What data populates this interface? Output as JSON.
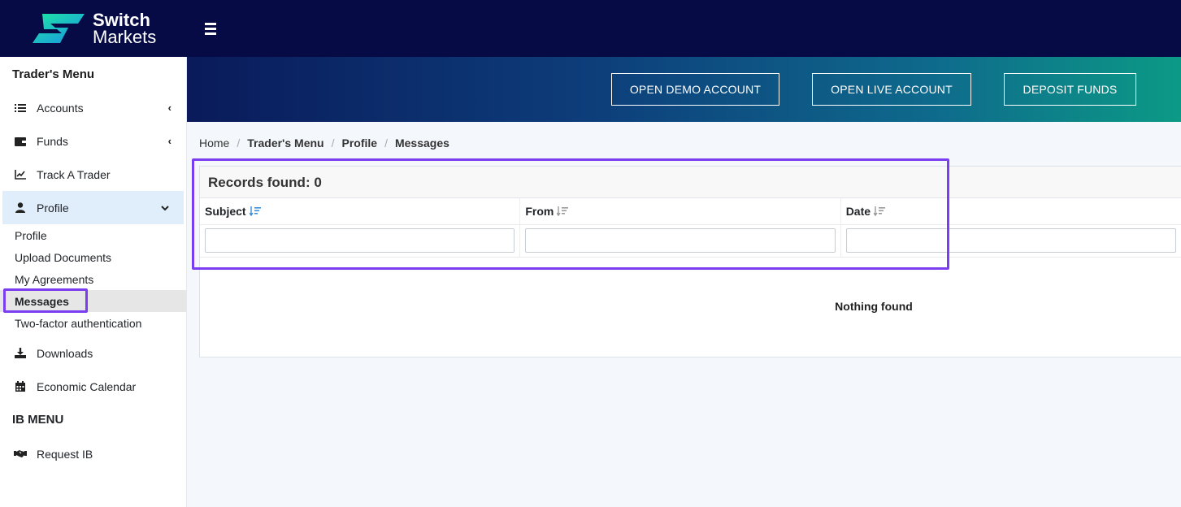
{
  "brand": {
    "line1": "Switch",
    "line2": "Markets"
  },
  "sidebar": {
    "heading": "Trader's Menu",
    "items": [
      {
        "label": "Accounts",
        "icon": "list-icon",
        "chevron": "‹"
      },
      {
        "label": "Funds",
        "icon": "wallet-icon",
        "chevron": "‹"
      },
      {
        "label": "Track A Trader",
        "icon": "chart-line-icon"
      },
      {
        "label": "Profile",
        "icon": "user-icon",
        "chevron": "⌄"
      }
    ],
    "profile_sub": [
      "Profile",
      "Upload Documents",
      "My Agreements",
      "Messages",
      "Two-factor authentication"
    ],
    "more_items": [
      {
        "label": "Downloads",
        "icon": "download-icon"
      },
      {
        "label": "Economic Calendar",
        "icon": "calendar-icon"
      }
    ],
    "ib_heading": "IB MENU",
    "ib_items": [
      {
        "label": "Request IB",
        "icon": "handshake-icon"
      }
    ]
  },
  "banner": {
    "buttons": [
      "OPEN DEMO ACCOUNT",
      "OPEN LIVE ACCOUNT",
      "DEPOSIT FUNDS"
    ]
  },
  "breadcrumb": [
    "Home",
    "Trader's Menu",
    "Profile",
    "Messages"
  ],
  "table": {
    "records_label": "Records found: 0",
    "columns": [
      "Subject",
      "From",
      "Date"
    ],
    "empty_text": "Nothing found"
  },
  "colors": {
    "topbar": "#060b45",
    "accent": "#7a3ef0",
    "active_item": "#e0eefc"
  }
}
